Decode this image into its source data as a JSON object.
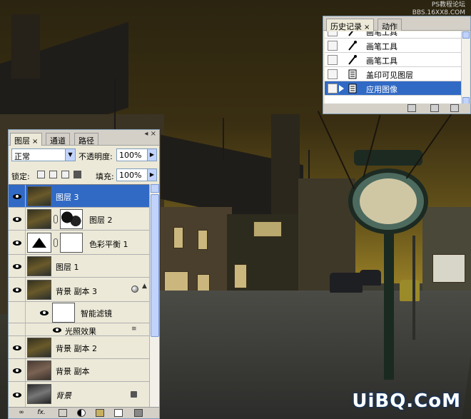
{
  "watermarks": {
    "top_line1": "PS教程论坛",
    "top_line2": "BBS.16XX8.COM",
    "bottom": "UiBQ.CoM"
  },
  "history_panel": {
    "tabs": [
      {
        "label": "历史记录",
        "active": true,
        "close": "×"
      },
      {
        "label": "动作",
        "active": false
      }
    ],
    "items": [
      {
        "label": "画笔工具",
        "icon": "brush-icon",
        "selected": false
      },
      {
        "label": "画笔工具",
        "icon": "brush-icon",
        "selected": false
      },
      {
        "label": "画笔工具",
        "icon": "brush-icon",
        "selected": false
      },
      {
        "label": "盖印可见图层",
        "icon": "document-icon",
        "selected": false
      },
      {
        "label": "应用图像",
        "icon": "document-icon",
        "selected": true
      }
    ]
  },
  "layers_panel": {
    "tabs": [
      {
        "label": "图层",
        "active": true,
        "close": "×"
      },
      {
        "label": "通道",
        "active": false
      },
      {
        "label": "路径",
        "active": false
      }
    ],
    "blend_mode": "正常",
    "opacity_label": "不透明度:",
    "opacity_value": "100%",
    "lock_label": "锁定:",
    "fill_label": "填充:",
    "fill_value": "100%",
    "layers": [
      {
        "name": "图层 3",
        "selected": true
      },
      {
        "name": "图层 2",
        "selected": false
      },
      {
        "name": "色彩平衡 1",
        "selected": false
      },
      {
        "name": "图层 1",
        "selected": false
      },
      {
        "name": "背景 副本 3",
        "selected": false
      },
      {
        "name": "智能滤镜",
        "selected": false
      },
      {
        "name": "光照效果",
        "selected": false
      },
      {
        "name": "背景 副本 2",
        "selected": false
      },
      {
        "name": "背景 副本",
        "selected": false
      },
      {
        "name": "背景",
        "selected": false
      }
    ],
    "footer_icons": [
      "link-icon",
      "fx-icon",
      "mask-icon",
      "adjustment-icon",
      "folder-icon",
      "new-layer-icon",
      "trash-icon"
    ],
    "footer_fx_label": "fx."
  }
}
